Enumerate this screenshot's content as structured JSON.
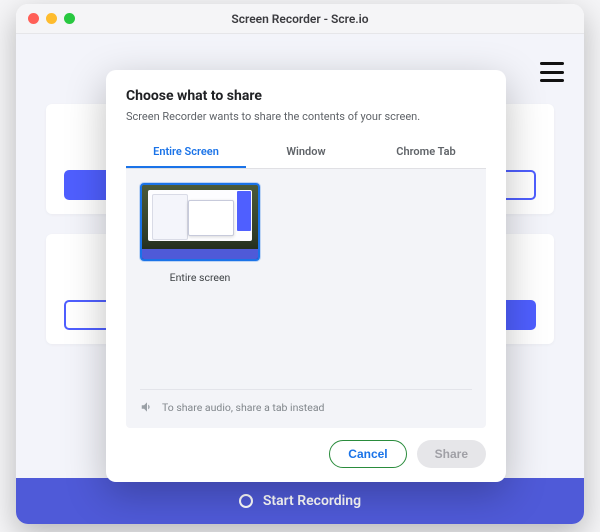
{
  "window": {
    "title": "Screen Recorder - Scre.io"
  },
  "bottom_bar": {
    "label": "Start Recording"
  },
  "modal": {
    "title": "Choose what to share",
    "description": "Screen Recorder wants to share the contents of your screen.",
    "tabs": {
      "entire_screen": "Entire Screen",
      "window": "Window",
      "chrome_tab": "Chrome Tab"
    },
    "thumb_label": "Entire screen",
    "audio_note": "To share audio, share a tab instead",
    "buttons": {
      "cancel": "Cancel",
      "share": "Share"
    }
  }
}
